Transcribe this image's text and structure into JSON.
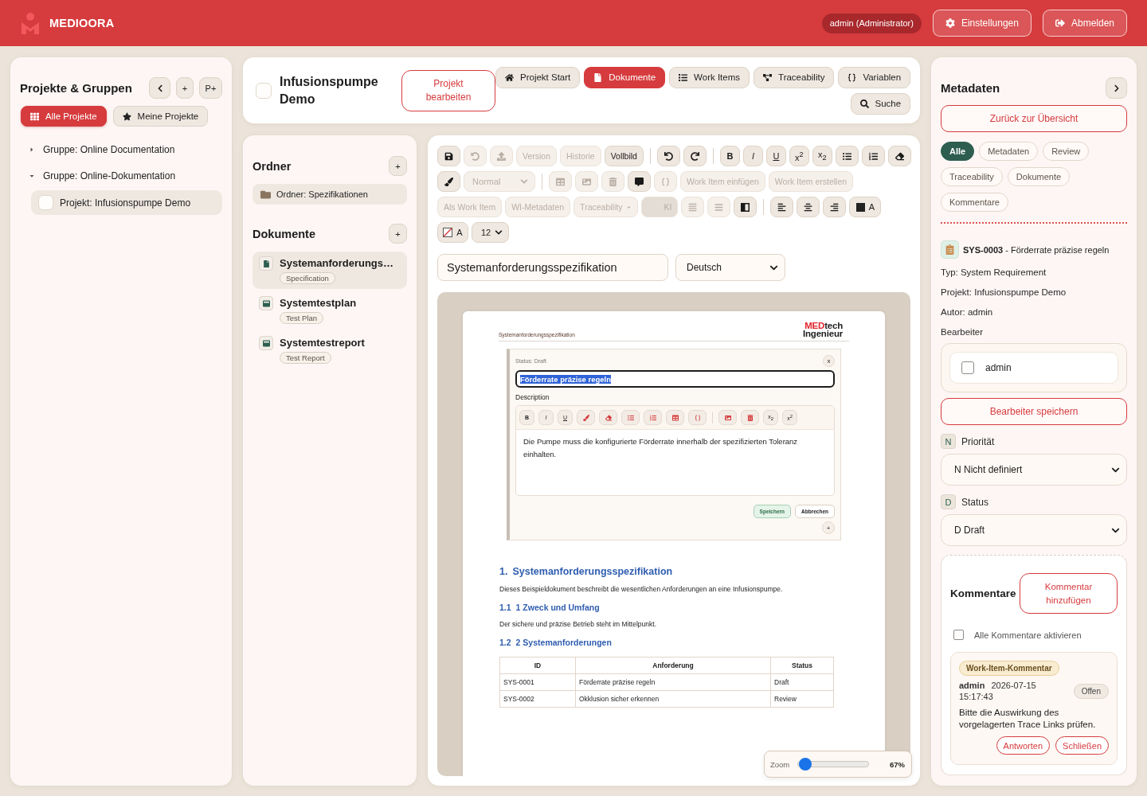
{
  "header": {
    "brand": "MEDIOORA",
    "user": "admin (Administrator)",
    "actions": [
      {
        "kind": "settings",
        "label": "Einstellungen"
      },
      {
        "kind": "logout",
        "label": "Abmelden"
      }
    ]
  },
  "projects_panel": {
    "title": "Projekte & Gruppen",
    "tools": [
      {
        "kind": "collapse"
      },
      {
        "kind": "add",
        "label": "+"
      },
      {
        "kind": "add-project",
        "label": "P+"
      }
    ],
    "filters": [
      {
        "kind": "all",
        "label": "Alle Projekte",
        "selected": true
      },
      {
        "kind": "mine",
        "label": "Meine Projekte",
        "selected": false
      }
    ],
    "tree": [
      {
        "label": "Gruppe: Online Documentation",
        "expanded": false
      },
      {
        "label": "Gruppe: Online-Dokumentation",
        "expanded": true,
        "children": [
          {
            "label": "Projekt: Infusionspumpe Demo",
            "selected": true,
            "checked": false
          }
        ]
      }
    ]
  },
  "project_bar": {
    "checked": false,
    "title": "Infusionspumpe Demo",
    "edit_button": "Projekt bearbeiten",
    "nav_rows": [
      [
        {
          "kind": "home",
          "label": "Projekt Start",
          "selected": false
        },
        {
          "kind": "documents",
          "label": "Dokumente",
          "selected": true
        },
        {
          "kind": "work-items",
          "label": "Work Items",
          "selected": false
        },
        {
          "kind": "traceability",
          "label": "Traceability",
          "selected": false
        },
        {
          "kind": "variables",
          "label": "Variablen",
          "selected": false
        }
      ],
      [
        {
          "kind": "search",
          "label": "Suche",
          "selected": false
        }
      ]
    ]
  },
  "folders": {
    "title": "Ordner",
    "add_button": "+",
    "items": [
      {
        "label": "Ordner: Spezifikationen"
      }
    ]
  },
  "documents": {
    "title": "Dokumente",
    "add_button": "+",
    "items": [
      {
        "kind": "specification",
        "title": "Systemanforderungs…",
        "type": "Specification",
        "selected": true
      },
      {
        "kind": "plan",
        "title": "Systemtestplan",
        "type": "Test Plan",
        "selected": false
      },
      {
        "kind": "report",
        "title": "Systemtestreport",
        "type": "Test Report",
        "selected": false
      }
    ]
  },
  "editor": {
    "toolbar_rows": [
      [
        {
          "kind": "save",
          "disabled": false
        },
        {
          "kind": "restore",
          "disabled": true
        },
        {
          "kind": "upload",
          "disabled": true
        },
        {
          "kind": "text",
          "label": "Version",
          "disabled": true
        },
        {
          "kind": "text",
          "label": "Historie",
          "disabled": true
        },
        {
          "kind": "text",
          "label": "Vollbild",
          "disabled": false
        },
        {
          "kind": "separator"
        },
        {
          "kind": "undo",
          "disabled": false
        },
        {
          "kind": "redo",
          "disabled": false
        },
        {
          "kind": "separator"
        },
        {
          "kind": "bold",
          "label": "B",
          "disabled": false
        },
        {
          "kind": "italic",
          "label": "I",
          "disabled": false
        },
        {
          "kind": "underline",
          "label": "U",
          "disabled": false
        },
        {
          "kind": "script",
          "label": "x$^{2}$",
          "disabled": false
        },
        {
          "kind": "script",
          "label": "x$_{2}$",
          "disabled": false
        },
        {
          "kind": "bullets",
          "disabled": false
        },
        {
          "kind": "numbered",
          "disabled": false
        },
        {
          "kind": "eraser",
          "disabled": false
        }
      ],
      [
        {
          "kind": "brush",
          "disabled": false
        },
        {
          "kind": "select",
          "label": "Normal",
          "disabled": true
        },
        {
          "kind": "separator"
        },
        {
          "kind": "table",
          "disabled": true
        },
        {
          "kind": "image",
          "disabled": true
        },
        {
          "kind": "delete",
          "disabled": true
        },
        {
          "kind": "comment",
          "disabled": false
        },
        {
          "kind": "variable",
          "disabled": true
        },
        {
          "kind": "text",
          "label": "Work Item einfügen",
          "disabled": true
        },
        {
          "kind": "text",
          "label": "Work Item erstellen",
          "disabled": true
        }
      ],
      [
        {
          "kind": "text",
          "label": "Als Work Item",
          "disabled": true
        },
        {
          "kind": "text",
          "label": "WI-Metadaten",
          "disabled": true
        },
        {
          "kind": "dropdown",
          "label": "Traceability",
          "disabled": true
        },
        {
          "kind": "ai",
          "label": "KI",
          "disabled": true
        },
        {
          "kind": "justify",
          "disabled": true
        },
        {
          "kind": "lines",
          "disabled": true
        },
        {
          "kind": "columns",
          "disabled": false
        },
        {
          "kind": "separator"
        },
        {
          "kind": "align-left",
          "disabled": false
        },
        {
          "kind": "align-center",
          "disabled": false
        },
        {
          "kind": "align-right",
          "disabled": false
        },
        {
          "kind": "text-color",
          "label": "A",
          "disabled": false
        }
      ],
      [
        {
          "kind": "highlight",
          "label": "A",
          "disabled": false
        },
        {
          "kind": "size-select",
          "label": "12",
          "disabled": false
        }
      ]
    ],
    "title_value": "Systemanforderungsspezifikation",
    "language": "Deutsch",
    "page": {
      "running_title": "Systemanforderungsspezifikation",
      "logo": {
        "accent": "MED",
        "rest": "tech",
        "line2": "Ingenieur"
      },
      "work_item": {
        "status": "Status: Draft",
        "close": "x",
        "title": "Förderrate präzise regeln",
        "title_highlighted": true,
        "description_label": "Description",
        "toolbar": [
          {
            "kind": "bold",
            "label": "B"
          },
          {
            "kind": "italic",
            "label": "I"
          },
          {
            "kind": "underline",
            "label": "U"
          },
          {
            "kind": "brush"
          },
          {
            "kind": "eraser"
          },
          {
            "kind": "bullets"
          },
          {
            "kind": "numbered"
          },
          {
            "kind": "table"
          },
          {
            "kind": "variable"
          },
          {
            "kind": "separator"
          },
          {
            "kind": "image"
          },
          {
            "kind": "delete"
          },
          {
            "kind": "script",
            "label": "x$_{2}$"
          },
          {
            "kind": "script",
            "label": "x$^{2}$"
          }
        ],
        "description": "Die Pumpe muss die konfigurierte Förderrate innerhalb der spezifizierten Toleranz einhalten.",
        "buttons": [
          {
            "kind": "save",
            "label": "Speichern"
          },
          {
            "kind": "cancel",
            "label": "Abbrechen"
          }
        ],
        "add_button": "+"
      },
      "blocks": [
        {
          "kind": "heading",
          "number": "1.",
          "title": "Systemanforderungsspezifikation"
        },
        {
          "kind": "paragraph",
          "text": "Dieses Beispieldokument beschreibt die wesentlichen Anforderungen an eine Infusionspumpe."
        },
        {
          "kind": "subheading",
          "number": "1.1",
          "title": "1 Zweck und Umfang"
        },
        {
          "kind": "paragraph",
          "text": "Der sichere und präzise Betrieb steht im Mittelpunkt."
        },
        {
          "kind": "subheading",
          "number": "1.2",
          "title": "2 Systemanforderungen"
        },
        {
          "kind": "table",
          "columns": [
            "ID",
            "Anforderung",
            "Status"
          ],
          "rows": [
            [
              "SYS-0001",
              "Förderrate präzise regeln",
              "Draft"
            ],
            [
              "SYS-0002",
              "Okklusion sicher erkennen",
              "Review"
            ]
          ]
        }
      ]
    },
    "zoom": {
      "label": "Zoom",
      "level": 0.03,
      "reading": "67%"
    }
  },
  "metadata_panel": {
    "title": "Metadaten",
    "back_button": "Zurück zur Übersicht",
    "filters": [
      {
        "label": "Alle",
        "selected": true
      },
      {
        "label": "Metadaten",
        "selected": false
      },
      {
        "label": "Review",
        "selected": false
      },
      {
        "label": "Traceability",
        "selected": false
      },
      {
        "label": "Dokumente",
        "selected": false
      },
      {
        "label": "Kommentare",
        "selected": false
      }
    ],
    "item": {
      "heading": "**SYS-0003** - Förderrate präzise regeln",
      "facts": [
        "Typ: System Requirement",
        "Projekt: Infusionspumpe Demo",
        "Autor: admin"
      ]
    },
    "assignees": {
      "label": "Bearbeiter",
      "options": [
        {
          "label": "admin",
          "checked": false
        }
      ],
      "save_button": "Bearbeiter speichern"
    },
    "fields": [
      {
        "badge": "N",
        "label": "Priorität",
        "value": "N Nicht definiert"
      },
      {
        "badge": "D",
        "label": "Status",
        "value": "D Draft"
      }
    ],
    "comments": {
      "title": "Kommentare",
      "add_button": "Kommentar hinzufügen",
      "enable_all": {
        "label": "Alle Kommentare aktivieren",
        "checked": false
      },
      "items": [
        {
          "tag": "Work-Item-Kommentar",
          "author": "admin",
          "timestamp": "2026-07-15 15:17:43",
          "status": "Offen",
          "text": "Bitte die Auswirkung des vorgelagerten Trace Links prüfen.",
          "actions": [
            "Antworten",
            "Schließen"
          ]
        }
      ]
    }
  }
}
